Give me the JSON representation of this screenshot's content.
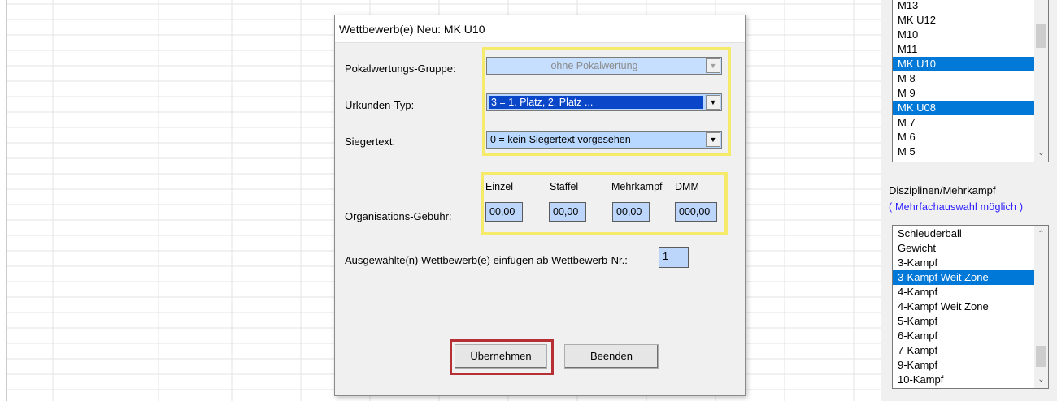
{
  "dialog": {
    "title": "Wettbewerb(e) Neu:  MK U10",
    "pokal_label": "Pokalwertungs-Gruppe:",
    "pokal_value": "ohne Pokalwertung",
    "urkunden_label": "Urkunden-Typ:",
    "urkunden_value": "3 = 1. Platz, 2. Platz ...",
    "sieger_label": "Siegertext:",
    "sieger_value": "0 = kein Siegertext vorgesehen",
    "fee_headers": [
      "Einzel",
      "Staffel",
      "Mehrkampf",
      "DMM"
    ],
    "fee_label": "Organisations-Gebühr:",
    "fee_values": [
      "00,00",
      "00,00",
      "00,00",
      "000,00"
    ],
    "insert_label": "Ausgewählte(n) Wettbewerb(e) einfügen ab Wettbewerb-Nr.:",
    "insert_value": "1",
    "apply_button": "Übernehmen",
    "close_button": "Beenden"
  },
  "right_panel": {
    "groups_list": [
      {
        "label": "M13",
        "selected": false
      },
      {
        "label": "MK U12",
        "selected": false
      },
      {
        "label": "M10",
        "selected": false
      },
      {
        "label": "M11",
        "selected": false
      },
      {
        "label": "MK U10",
        "selected": true
      },
      {
        "label": "M 8",
        "selected": false
      },
      {
        "label": "M 9",
        "selected": false
      },
      {
        "label": "MK U08",
        "selected": true
      },
      {
        "label": "M 7",
        "selected": false
      },
      {
        "label": "M 6",
        "selected": false
      },
      {
        "label": "M 5",
        "selected": false
      }
    ],
    "disciplines_label": "Disziplinen/Mehrkampf",
    "multi_select_hint": "( Mehrfachauswahl möglich )",
    "disciplines_list": [
      {
        "label": "Schleuderball",
        "selected": false
      },
      {
        "label": "Gewicht",
        "selected": false
      },
      {
        "label": "3-Kampf",
        "selected": false
      },
      {
        "label": "3-Kampf Weit Zone",
        "selected": true
      },
      {
        "label": "4-Kampf",
        "selected": false
      },
      {
        "label": "4-Kampf Weit Zone",
        "selected": false
      },
      {
        "label": "5-Kampf",
        "selected": false
      },
      {
        "label": "6-Kampf",
        "selected": false
      },
      {
        "label": "7-Kampf",
        "selected": false
      },
      {
        "label": "9-Kampf",
        "selected": false
      },
      {
        "label": "10-Kampf",
        "selected": false
      }
    ]
  },
  "colors": {
    "highlight_yellow": "#f5ea6a",
    "highlight_red": "#b52f35",
    "selection_blue": "#0078d7"
  }
}
